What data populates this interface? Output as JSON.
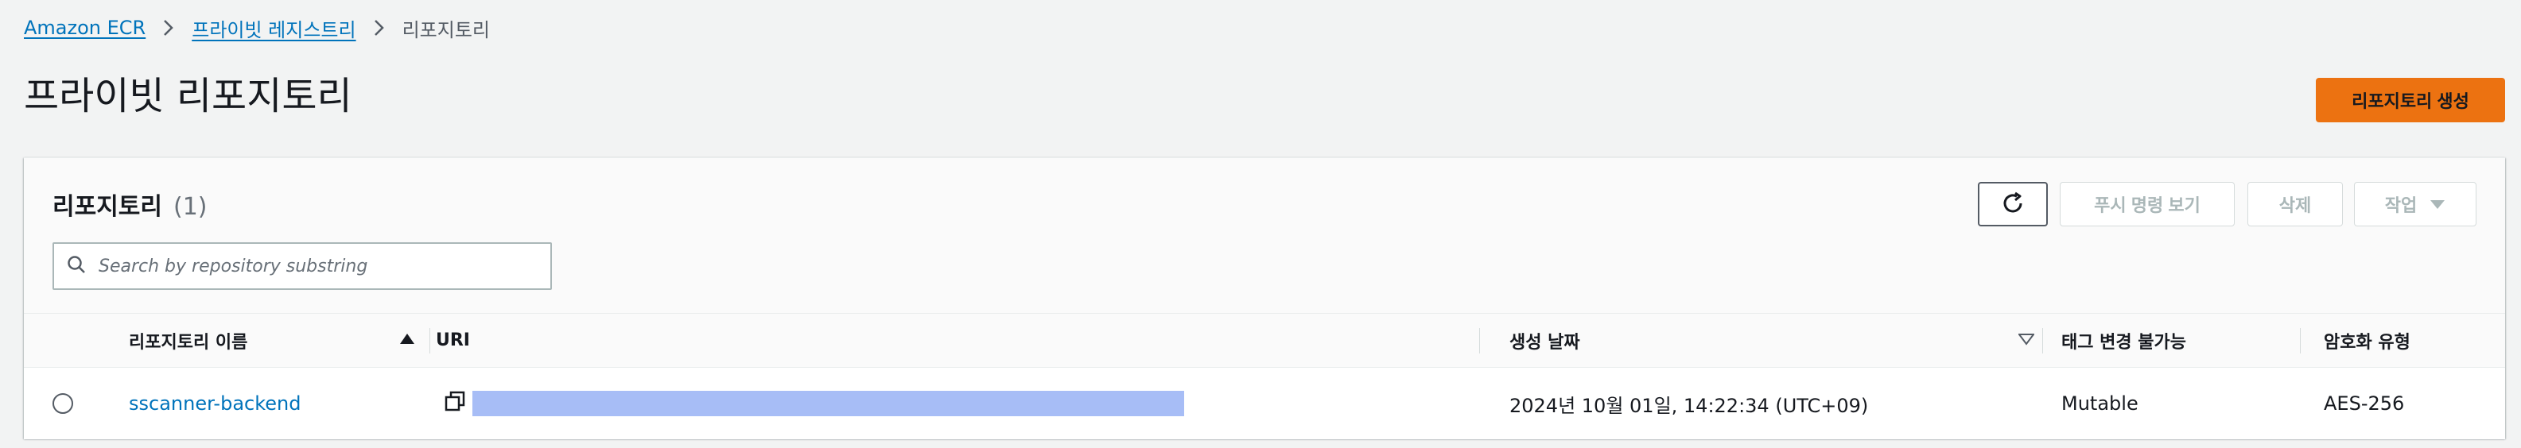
{
  "breadcrumb": {
    "items": [
      "Amazon ECR",
      "프라이빗 레지스트리",
      "리포지토리"
    ]
  },
  "page": {
    "title": "프라이빗 리포지토리",
    "create_button": "리포지토리 생성"
  },
  "panel": {
    "title": "리포지토리",
    "count": "(1)",
    "buttons": {
      "refresh_icon": "refresh-icon",
      "push_commands": "푸시 명령 보기",
      "delete": "삭제",
      "actions": "작업"
    },
    "search": {
      "placeholder": "Search by repository substring",
      "value": ""
    }
  },
  "table": {
    "columns": [
      "리포지토리 이름",
      "URI",
      "생성 날짜",
      "태그 변경 불가능",
      "암호화 유형"
    ],
    "sort": {
      "column": "리포지토리 이름",
      "direction": "ascending"
    },
    "rows": [
      {
        "selected": false,
        "name": "sscanner-backend",
        "uri": "",
        "created": "2024년 10월 01일, 14:22:34 (UTC+09)",
        "tag_immutability": "Mutable",
        "encryption": "AES-256"
      }
    ]
  },
  "colors": {
    "accent": "#ec7211",
    "link": "#0073bb",
    "uri_redaction": "#a7bdf6"
  }
}
